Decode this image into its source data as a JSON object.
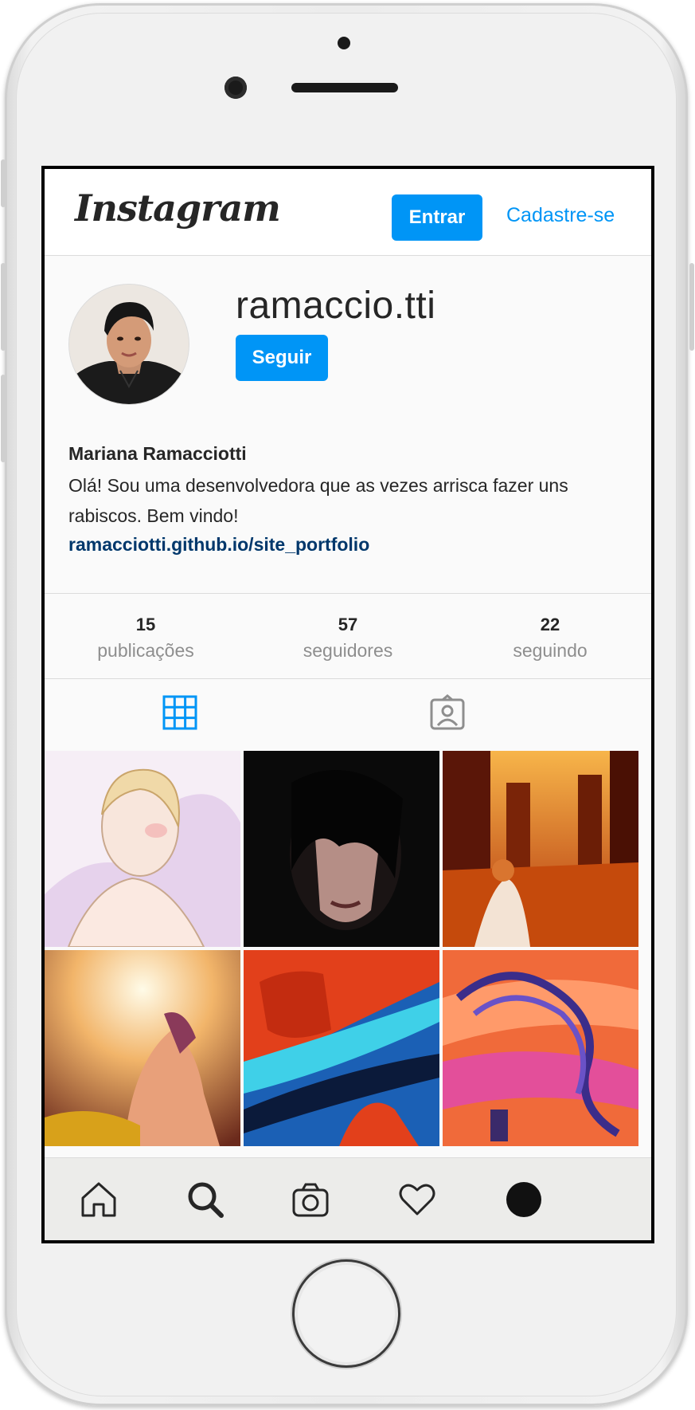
{
  "header": {
    "logo_text": "Instagram",
    "login_label": "Entrar",
    "signup_label": "Cadastre-se"
  },
  "profile": {
    "username": "ramaccio.tti",
    "follow_label": "Seguir",
    "full_name": "Mariana Ramacciotti",
    "bio": "Olá! Sou uma desenvolvedora que as vezes arrisca fazer uns rabiscos. Bem vindo!",
    "website": "ramacciotti.github.io/site_portfolio"
  },
  "stats": [
    {
      "value": "15",
      "label": "publicações"
    },
    {
      "value": "57",
      "label": "seguidores"
    },
    {
      "value": "22",
      "label": "seguindo"
    }
  ],
  "tabs": [
    {
      "icon": "grid-icon",
      "active": true
    },
    {
      "icon": "tagged-icon",
      "active": false
    }
  ],
  "bottom_nav": [
    "home-icon",
    "search-icon",
    "camera-icon",
    "heart-icon",
    "profile-icon"
  ],
  "colors": {
    "accent": "#0095f6",
    "link": "#00376b",
    "text": "#262626",
    "muted": "#8e8e8e"
  }
}
